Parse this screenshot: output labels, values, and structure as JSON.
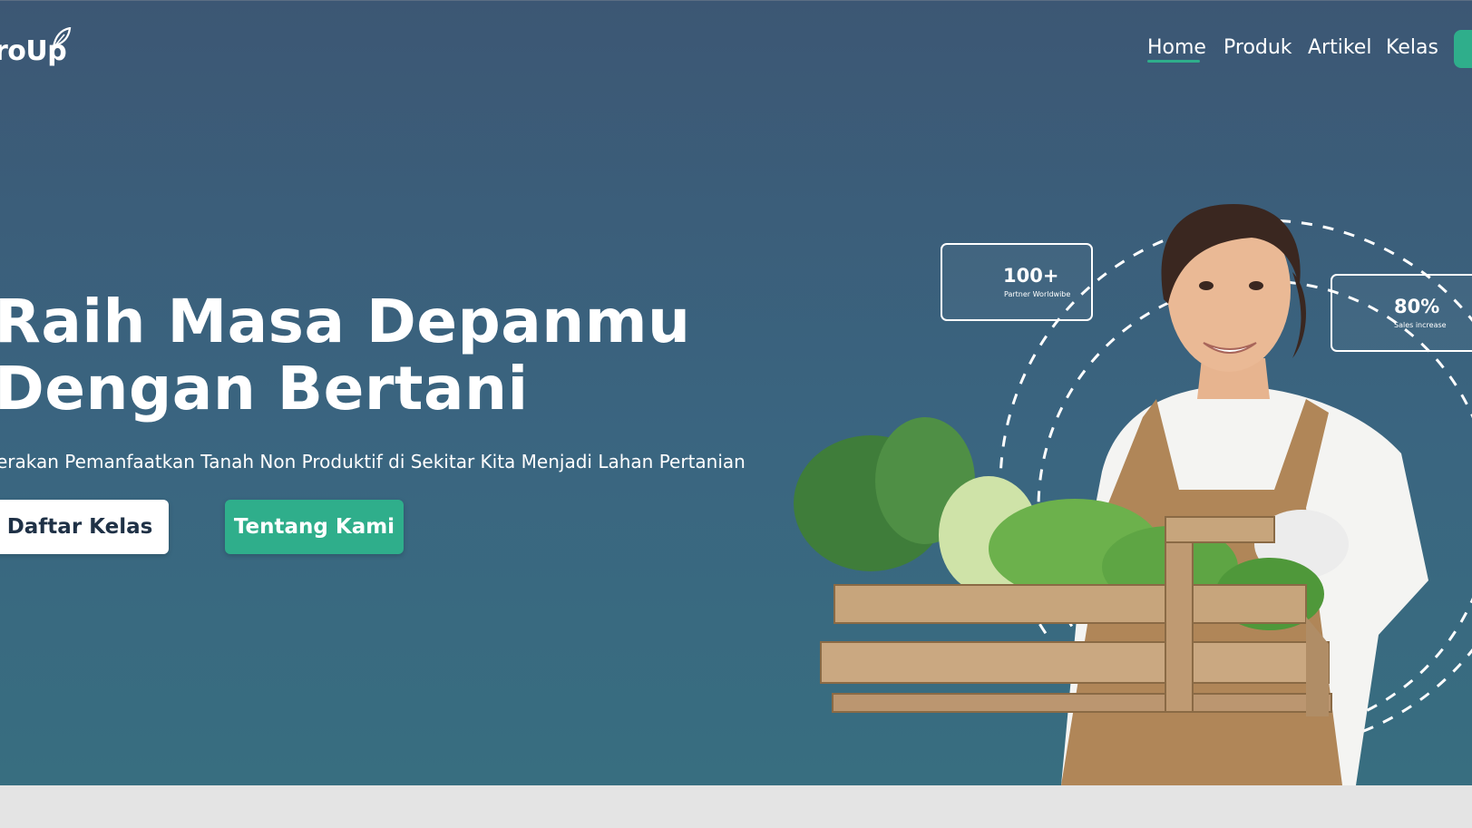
{
  "brand": {
    "name": "roUp"
  },
  "nav": {
    "items": [
      {
        "label": "Home",
        "active": true
      },
      {
        "label": "Produk",
        "active": false
      },
      {
        "label": "Artikel",
        "active": false
      },
      {
        "label": "Kelas",
        "active": false
      }
    ],
    "cta_label": ""
  },
  "hero": {
    "title_line1": "Raih Masa Depanmu",
    "title_line2": "Dengan Bertani",
    "subtitle": "erakan Pemanfaatkan Tanah Non Produktif di Sekitar Kita Menjadi Lahan Pertanian",
    "primary_button": "Daftar Kelas",
    "secondary_button": "Tentang Kami"
  },
  "stats": [
    {
      "value": "100+",
      "label": "Partner Worldwibe"
    },
    {
      "value": "80%",
      "label": "Sales increase"
    }
  ],
  "colors": {
    "hero_top": "#3c5774",
    "hero_bottom": "#386e80",
    "accent_green": "#2fae8b",
    "footer_band": "#e4e4e4"
  }
}
